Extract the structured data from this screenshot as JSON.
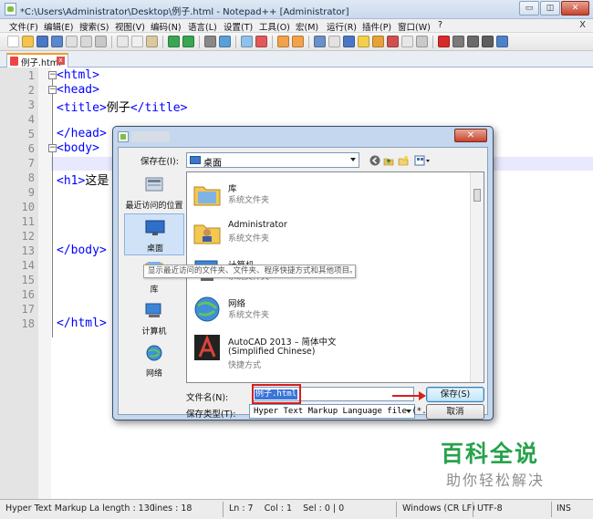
{
  "window": {
    "title": "*C:\\Users\\Administrator\\Desktop\\例子.html - Notepad++ [Administrator]",
    "btn_min": "▭",
    "btn_max": "◫",
    "btn_close": "✕"
  },
  "menu": {
    "items": [
      "文件(F)",
      "编辑(E)",
      "搜索(S)",
      "视图(V)",
      "编码(N)",
      "语言(L)",
      "设置(T)",
      "工具(O)",
      "宏(M)",
      "运行(R)",
      "插件(P)",
      "窗口(W)",
      "?"
    ],
    "close_x": "X"
  },
  "tab": {
    "label": "例子.html",
    "close": "x"
  },
  "editor": {
    "line_numbers": [
      "1",
      "2",
      "3",
      "4",
      "5",
      "6",
      "7",
      "8",
      "9",
      "10",
      "11",
      "12",
      "13",
      "14",
      "15",
      "16",
      "17",
      "18"
    ],
    "lines": [
      {
        "tag": "<html>",
        "text": ""
      },
      {
        "tag": "<head>",
        "text": ""
      },
      {
        "tag": "<title>",
        "text": "例子",
        "close": "</title>"
      },
      {
        "tag": "",
        "text": ""
      },
      {
        "tag": "</head>",
        "text": ""
      },
      {
        "tag": "<body>",
        "text": ""
      },
      {
        "tag": "",
        "text": ""
      },
      {
        "tag": "<h1>",
        "text": "这是"
      },
      {
        "tag": "",
        "text": ""
      },
      {
        "tag": "",
        "text": ""
      },
      {
        "tag": "",
        "text": ""
      },
      {
        "tag": "",
        "text": ""
      },
      {
        "tag": "</body>",
        "text": ""
      },
      {
        "tag": "",
        "text": ""
      },
      {
        "tag": "",
        "text": ""
      },
      {
        "tag": "",
        "text": ""
      },
      {
        "tag": "",
        "text": ""
      },
      {
        "tag": "</html>",
        "text": ""
      }
    ]
  },
  "dialog": {
    "close": "✕",
    "save_in_label": "保存在(I):",
    "save_in_value": "桌面",
    "places": [
      {
        "label": "最近访问的位置",
        "icon": "recent-places-icon"
      },
      {
        "label": "桌面",
        "icon": "desktop-icon"
      },
      {
        "label": "库",
        "icon": "library-icon"
      },
      {
        "label": "计算机",
        "icon": "computer-icon"
      },
      {
        "label": "网络",
        "icon": "network-icon"
      }
    ],
    "files": [
      {
        "name": "库",
        "sub": "系统文件夹",
        "icon": "library-folder-icon"
      },
      {
        "name": "Administrator",
        "sub": "系统文件夹",
        "icon": "user-folder-icon"
      },
      {
        "name": "计算机",
        "sub": "系统文件夹",
        "icon": "computer-icon"
      },
      {
        "name": "网络",
        "sub": "系统文件夹",
        "icon": "network-globe-icon"
      },
      {
        "name": "AutoCAD 2013 – 简体中文",
        "name2": "(Simplified Chinese)",
        "sub": "快捷方式",
        "icon": "autocad-icon"
      }
    ],
    "tooltip": "显示最近访问的文件夹、文件夹、程序快捷方式和其他项目。",
    "filename_label": "文件名(N):",
    "filename_value": "例子.html",
    "filetype_label": "保存类型(T):",
    "filetype_value": "Hyper Text Markup Language file (*.ht",
    "save_button": "保存(S)",
    "cancel_button": "取消"
  },
  "status": {
    "filetype": "Hyper Text Markup La length : 130",
    "lines": "lines : 18",
    "pos": "Ln : 7    Col : 1    Sel : 0 | 0",
    "eol": "Windows (CR LF)",
    "encoding": "UTF-8",
    "mode": "INS"
  },
  "watermark": {
    "main": "百科全说",
    "sub": "助你轻松解决"
  },
  "colors": {
    "tag": "#0000ff",
    "accent_tab": "#f39b2b",
    "highlight": "#d6201d",
    "watermark_green": "#27a24b"
  }
}
